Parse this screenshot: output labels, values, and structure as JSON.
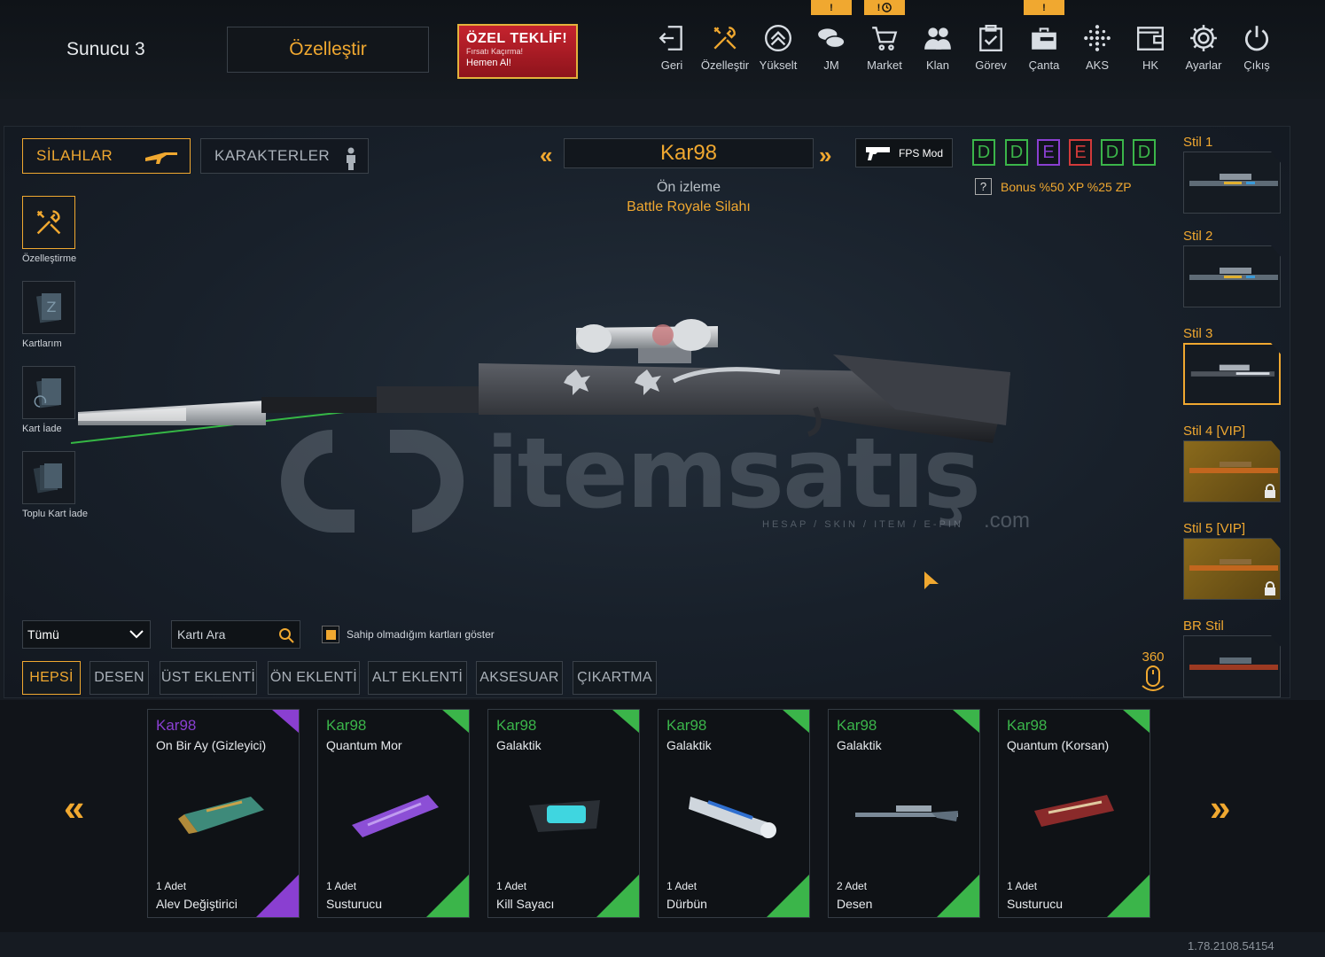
{
  "header": {
    "server": "Sunucu 3",
    "customize_button": "Özelleştir",
    "offer": {
      "title": "ÖZEL TEKLİF!",
      "subtitle": "Fırsatı Kaçırma!",
      "cta": "Hemen Al!"
    },
    "nav": [
      {
        "label": "Geri",
        "icon": "back-icon"
      },
      {
        "label": "Özelleştir",
        "icon": "wrench-icon"
      },
      {
        "label": "Yükselt",
        "icon": "rank-up-icon"
      },
      {
        "label": "JM",
        "icon": "coins-icon"
      },
      {
        "label": "Market",
        "icon": "cart-icon"
      },
      {
        "label": "Klan",
        "icon": "clan-icon"
      },
      {
        "label": "Görev",
        "icon": "clipboard-icon"
      },
      {
        "label": "Çanta",
        "icon": "bag-icon"
      },
      {
        "label": "AKS",
        "icon": "dots-icon"
      },
      {
        "label": "HK",
        "icon": "wallet-icon"
      },
      {
        "label": "Ayarlar",
        "icon": "gear-icon"
      },
      {
        "label": "Çıkış",
        "icon": "power-icon"
      }
    ],
    "alerts": {
      "jm": "!",
      "market": "!",
      "canta": "!"
    }
  },
  "tabs": {
    "weapons": "SİLAHLAR",
    "characters": "KARAKTERLER"
  },
  "sidebar": [
    {
      "label": "Özelleştirme",
      "icon": "wrench-icon"
    },
    {
      "label": "Kartlarım",
      "icon": "cards-icon"
    },
    {
      "label": "Kart İade",
      "icon": "card-return-icon"
    },
    {
      "label": "Toplu Kart İade",
      "icon": "bulk-card-return-icon"
    }
  ],
  "weapon": {
    "name": "Kar98",
    "preview_label": "Ön izleme",
    "preview_mode": "Battle Royale Silahı",
    "fps_mode": "FPS Mod",
    "grades": [
      "D",
      "D",
      "E",
      "E",
      "D",
      "D"
    ],
    "bonus": "Bonus %50 XP %25 ZP",
    "bonus_help": "?"
  },
  "styles": [
    {
      "label": "Stil 1"
    },
    {
      "label": "Stil 2"
    },
    {
      "label": "Stil 3"
    },
    {
      "label": "Stil 4 [VIP]"
    },
    {
      "label": "Stil 5 [VIP]"
    },
    {
      "label": "BR Stil"
    }
  ],
  "rotate_label": "360",
  "filters": {
    "select": "Tümü",
    "search_placeholder": "Kartı Ara",
    "show_unowned": "Sahip olmadığım kartları göster",
    "tabs": [
      "HEPSİ",
      "DESEN",
      "ÜST EKLENTİ",
      "ÖN EKLENTİ",
      "ALT EKLENTİ",
      "AKSESUAR",
      "ÇIKARTMA"
    ]
  },
  "cards": [
    {
      "weapon": "Kar98",
      "skin": "On Bir Ay (Gizleyici)",
      "count": "1 Adet",
      "type": "Alev Değiştirici",
      "rarity": "purple"
    },
    {
      "weapon": "Kar98",
      "skin": "Quantum Mor",
      "count": "1 Adet",
      "type": "Susturucu",
      "rarity": "green"
    },
    {
      "weapon": "Kar98",
      "skin": "Galaktik",
      "count": "1 Adet",
      "type": "Kill Sayacı",
      "rarity": "green"
    },
    {
      "weapon": "Kar98",
      "skin": "Galaktik",
      "count": "1 Adet",
      "type": "Dürbün",
      "rarity": "green"
    },
    {
      "weapon": "Kar98",
      "skin": "Galaktik",
      "count": "2 Adet",
      "type": "Desen",
      "rarity": "green"
    },
    {
      "weapon": "Kar98",
      "skin": "Quantum (Korsan)",
      "count": "1 Adet",
      "type": "Susturucu",
      "rarity": "green"
    }
  ],
  "watermark": {
    "brand": "itemsatış",
    "tagline": "HESAP / SKIN / ITEM / E-PIN",
    "suffix": ".com"
  },
  "version": "1.78.2108.54154",
  "colors": {
    "accent": "#f0a830",
    "green": "#3bb54a",
    "purple": "#8a3fd1",
    "red": "#d23a3a"
  }
}
